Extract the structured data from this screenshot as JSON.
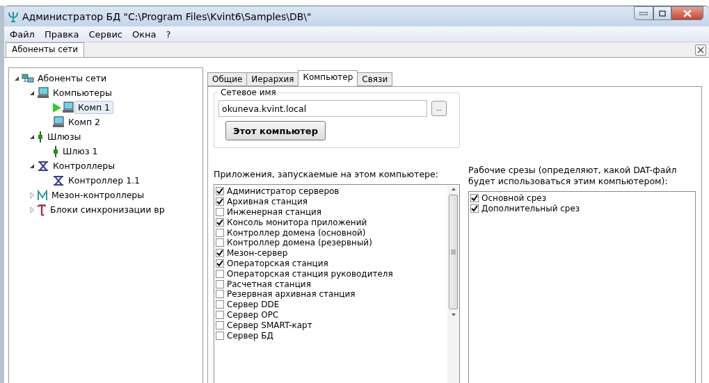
{
  "window": {
    "title": "Администратор БД \"C:\\Program Files\\Kvint6\\Samples\\DB\\\""
  },
  "menu": [
    "Файл",
    "Правка",
    "Сервис",
    "Окна",
    "?"
  ],
  "document_tabs": [
    {
      "label": "Абоненты сети",
      "selected": true
    }
  ],
  "tree": [
    {
      "label": "Абоненты сети",
      "kind": "network",
      "expanded": true,
      "selected": false,
      "children": [
        {
          "label": "Компьютеры",
          "kind": "computer",
          "expanded": true,
          "selected": false,
          "children": [
            {
              "label": "Комп 1",
              "kind": "computer",
              "selected": true,
              "running": true
            },
            {
              "label": "Комп 2",
              "kind": "computer",
              "selected": false,
              "running": false
            }
          ]
        },
        {
          "label": "Шлюзы",
          "kind": "gateway",
          "expanded": true,
          "selected": false,
          "children": [
            {
              "label": "Шлюз 1",
              "kind": "gateway",
              "selected": false
            }
          ]
        },
        {
          "label": "Контроллеры",
          "kind": "controller",
          "expanded": true,
          "selected": false,
          "children": [
            {
              "label": "Контроллер 1.1",
              "kind": "controller",
              "selected": false
            }
          ]
        },
        {
          "label": "Мезон-контроллеры",
          "kind": "mezon",
          "expanded": false,
          "selected": false
        },
        {
          "label": "Блоки синхронизации вр",
          "kind": "sync",
          "expanded": false,
          "selected": false
        }
      ]
    }
  ],
  "tabs": [
    {
      "label": "Общие",
      "selected": false
    },
    {
      "label": "Иерархия",
      "selected": false
    },
    {
      "label": "Компьютер",
      "selected": true
    },
    {
      "label": "Связи",
      "selected": false
    }
  ],
  "network_name": {
    "legend": "Сетевое имя",
    "value": "okuneva.kvint.local",
    "browse_button": "...",
    "this_computer_button": "Этот компьютер"
  },
  "applications": {
    "label": "Приложения, запускаемые на этом компьютере:",
    "items": [
      {
        "label": "Администратор серверов",
        "checked": true
      },
      {
        "label": "Архивная станция",
        "checked": true
      },
      {
        "label": "Инженерная станция",
        "checked": false
      },
      {
        "label": "Консоль монитора приложений",
        "checked": true
      },
      {
        "label": "Контроллер домена (основной)",
        "checked": false
      },
      {
        "label": "Контроллер домена (резервный)",
        "checked": false
      },
      {
        "label": "Мезон-сервер",
        "checked": true
      },
      {
        "label": "Операторская станция",
        "checked": true
      },
      {
        "label": "Операторская станция руководителя",
        "checked": false
      },
      {
        "label": "Расчетная станция",
        "checked": false
      },
      {
        "label": "Резервная архивная станция",
        "checked": false
      },
      {
        "label": "Сервер DDE",
        "checked": false
      },
      {
        "label": "Сервер OPC",
        "checked": false
      },
      {
        "label": "Сервер SMART-карт",
        "checked": false
      },
      {
        "label": "Сервер БД",
        "checked": false
      }
    ]
  },
  "work_slices": {
    "label": "Рабочие срезы (определяют, какой DAT-файл будет использоваться этим компьютером):",
    "items": [
      {
        "label": "Основной срез",
        "checked": true
      },
      {
        "label": "Дополнительный срез",
        "checked": true
      }
    ]
  }
}
